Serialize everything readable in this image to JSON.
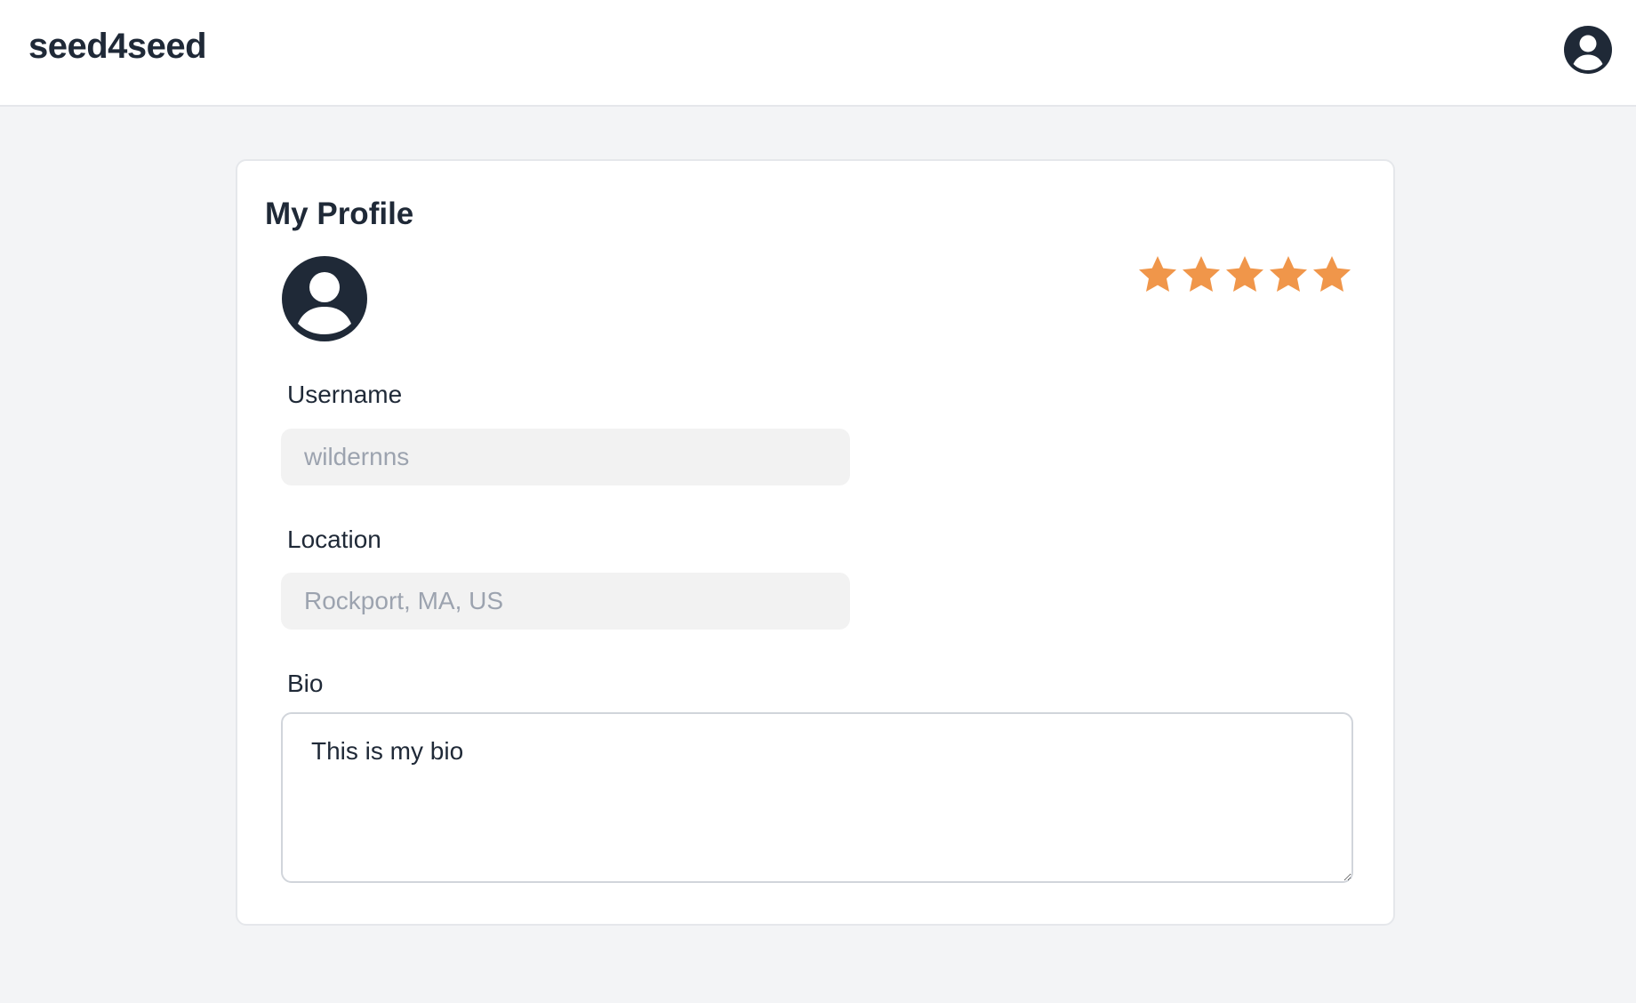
{
  "header": {
    "brand": "seed4seed",
    "account_icon": "user-circle-icon"
  },
  "profile": {
    "title": "My Profile",
    "avatar_icon": "user-circle-icon",
    "rating": {
      "value": 5,
      "max": 5,
      "star_color": "#f0964a",
      "icon": "star-icon"
    },
    "fields": {
      "username": {
        "label": "Username",
        "placeholder": "wildernns"
      },
      "location": {
        "label": "Location",
        "placeholder": "Rockport, MA, US"
      },
      "bio": {
        "label": "Bio",
        "value": "This is my bio"
      }
    }
  },
  "colors": {
    "text": "#1f2937",
    "background": "#f3f4f6",
    "input_background": "#f2f2f2",
    "placeholder": "#9ca3af",
    "star": "#f0964a"
  }
}
